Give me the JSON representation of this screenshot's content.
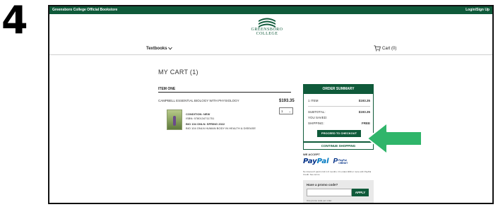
{
  "step_number": "4",
  "topbar": {
    "store_name": "Greensboro College Official Bookstore",
    "login": "Login/Sign Up"
  },
  "logo": {
    "line1": "GREENSBORO",
    "line2": "COLLEGE"
  },
  "nav": {
    "textbooks": "Textbooks",
    "cart": "Cart (0)"
  },
  "cart": {
    "title": "MY CART (1)",
    "item_heading": "ITEM ONE",
    "book_title": "CAMPBELL ESSENTIAL BIOLOGY WITH PHYSIOLOGY",
    "price": "$193.35",
    "quantity": "1",
    "condition": "CONDITION: NEW",
    "isbn": "ISBN: 9780134711751",
    "course": "BIO 104 ONLN: SPRING 2022",
    "course_desc": "BIO 104 ONLN HUMAN BODY IN HEALTH & DISEASE"
  },
  "summary": {
    "header": "ORDER SUMMARY",
    "items_label": "1 ITEM",
    "items_value": "$193.35",
    "subtotal_label": "SUBTOTAL:",
    "subtotal_value": "$193.35",
    "saved_label": "YOU SAVED:",
    "shipping_label": "SHIPPING:",
    "shipping_value": "FREE",
    "checkout_label": "PROCEED TO CHECKOUT"
  },
  "continue_label": "CONTINUE SHOPPING",
  "payments": {
    "we_accept": "WE ACCEPT",
    "paypal_pay": "Pay",
    "paypal_pal": "Pal",
    "credit_line1": "PayPal",
    "credit_line2": "CREDIT"
  },
  "fine_print": "No Interest if paid in full in 6 months. On orders $99 or more with PayPal Credit. See terms.",
  "promo": {
    "question": "Have a promo code?",
    "apply": "APPLY",
    "note": "One promo code per order."
  },
  "colors": {
    "brand_green": "#0f5a3a",
    "arrow_green": "#2fb56a"
  },
  "icons": [
    "chevron-down-icon",
    "cart-icon",
    "arrow-left-icon",
    "college-logo"
  ]
}
